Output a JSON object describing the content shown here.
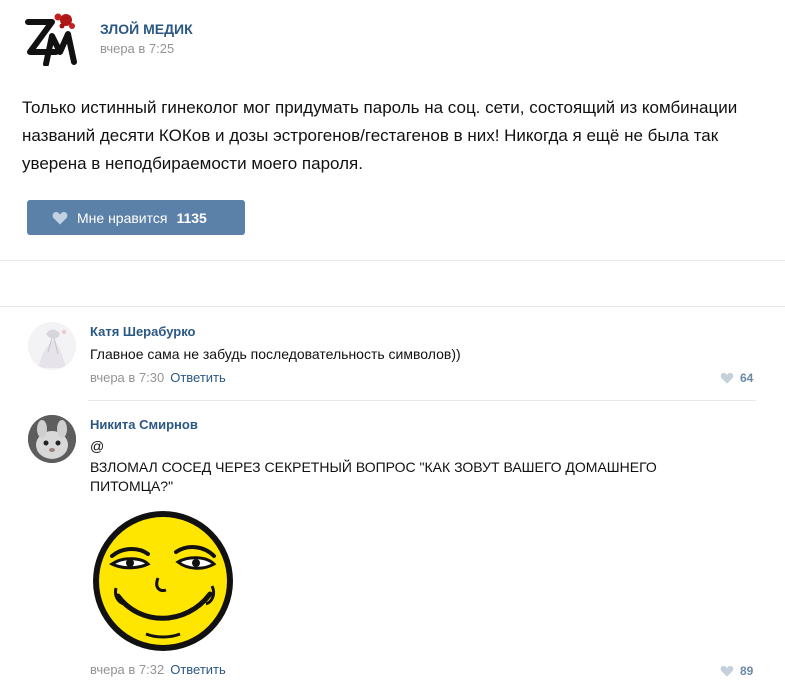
{
  "post": {
    "author": "ЗЛОЙ МЕДИК",
    "time": "вчера в 7:25",
    "text": "Только истинный гинеколог мог придумать пароль на соц. сети, состоящий из комбинации названий десяти КОКов и дозы эстрогенов/гестагенов в них! Никогда я ещё не была так уверена в неподбираемости моего пароля.",
    "like_label": "Мне нравится",
    "like_count": "1135",
    "logo_text": "ЗМ"
  },
  "comments": [
    {
      "author": "Катя Шерабурко",
      "text": "Главное сама не забудь последовательность символов))",
      "time": "вчера в 7:30",
      "reply_label": "Ответить",
      "likes": "64"
    },
    {
      "author": "Никита Смирнов",
      "text_line1": "@",
      "text_line2": "ВЗЛОМАЛ СОСЕД ЧЕРЕЗ СЕКРЕТНЫЙ ВОПРОС \"КАК ЗОВУТ ВАШЕГО ДОМАШНЕГО ПИТОМЦА?\"",
      "time": "вчера в 7:32",
      "reply_label": "Ответить",
      "likes": "89"
    }
  ],
  "colors": {
    "link": "#2a5885",
    "button": "#5b81a8",
    "muted": "#939393",
    "separator": "#e7e8ec"
  }
}
